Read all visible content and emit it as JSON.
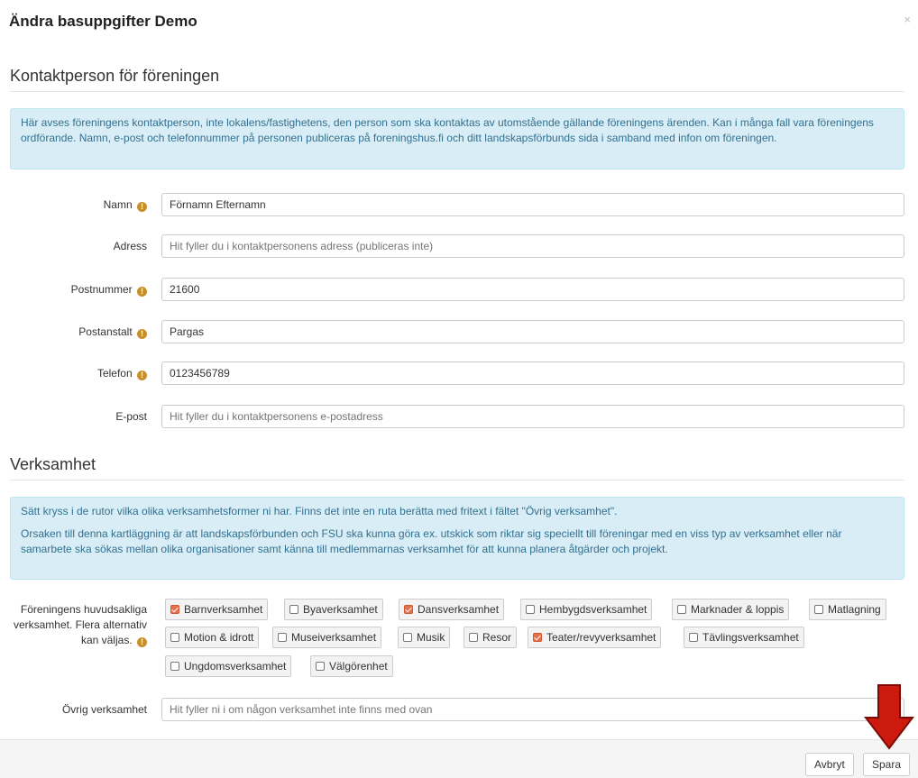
{
  "modal": {
    "title": "Ändra basuppgifter Demo",
    "close_glyph": "×"
  },
  "contact": {
    "section_title": "Kontaktperson för föreningen",
    "info_text": "Här avses föreningens kontaktperson, inte lokalens/fastighetens, den person som ska kontaktas av utomstående gällande föreningens ärenden. Kan i många fall vara föreningens ordförande. Namn, e-post och telefonnummer på personen publiceras på foreningshus.fi och ditt landskapsförbunds sida i samband med infon om föreningen.",
    "fields": {
      "namn": {
        "label": "Namn",
        "value": "Förnamn Efternamn",
        "placeholder": ""
      },
      "adress": {
        "label": "Adress",
        "value": "",
        "placeholder": "Hit fyller du i kontaktpersonens adress (publiceras inte)"
      },
      "postnummer": {
        "label": "Postnummer",
        "value": "21600",
        "placeholder": ""
      },
      "postanstalt": {
        "label": "Postanstalt",
        "value": "Pargas",
        "placeholder": ""
      },
      "telefon": {
        "label": "Telefon",
        "value": "0123456789",
        "placeholder": ""
      },
      "epost": {
        "label": "E-post",
        "value": "",
        "placeholder": "Hit fyller du i kontaktpersonens e-postadress"
      }
    }
  },
  "activity": {
    "section_title": "Verksamhet",
    "info_line1": "Sätt kryss i de rutor vilka olika verksamhetsformer ni har. Finns det inte en ruta berätta med fritext i fältet \"Övrig verksamhet\".",
    "info_line2": "Orsaken till denna kartläggning är att landskapsförbunden och FSU ska kunna göra ex. utskick som riktar sig speciellt till föreningar med en viss typ av verksamhet eller när samarbete ska sökas mellan olika organisationer samt känna till medlemmarnas verksamhet för att kunna planera åtgärder och projekt.",
    "main_label": "Föreningens huvudsakliga verksamhet. Flera alternativ kan väljas.",
    "options": [
      {
        "label": "Barnverksamhet",
        "checked": true
      },
      {
        "label": "Byaverksamhet",
        "checked": false
      },
      {
        "label": "Dansverksamhet",
        "checked": true
      },
      {
        "label": "Hembygdsverksamhet",
        "checked": false
      },
      {
        "label": "Marknader & loppis",
        "checked": false
      },
      {
        "label": "Matlagning",
        "checked": false
      },
      {
        "label": "Motion & idrott",
        "checked": false
      },
      {
        "label": "Museiverksamhet",
        "checked": false
      },
      {
        "label": "Musik",
        "checked": false
      },
      {
        "label": "Resor",
        "checked": false
      },
      {
        "label": "Teater/revyverksamhet",
        "checked": true
      },
      {
        "label": "Tävlingsverksamhet",
        "checked": false
      },
      {
        "label": "Ungdomsverksamhet",
        "checked": false
      },
      {
        "label": "Välgörenhet",
        "checked": false
      }
    ],
    "other": {
      "label": "Övrig verksamhet",
      "value": "",
      "placeholder": "Hit fyller ni i om någon verksamhet inte finns med ovan"
    }
  },
  "footer": {
    "cancel_label": "Avbryt",
    "save_label": "Spara"
  },
  "colors": {
    "alert_bg": "#d9edf7",
    "alert_text": "#31708f",
    "check_accent": "#e8704a",
    "info_icon": "#c8902b",
    "annotation_arrow": "#cc1a0e"
  },
  "icons": {
    "info": "exclamation-circle-icon",
    "close": "close-icon",
    "arrow": "red-down-arrow-icon"
  }
}
